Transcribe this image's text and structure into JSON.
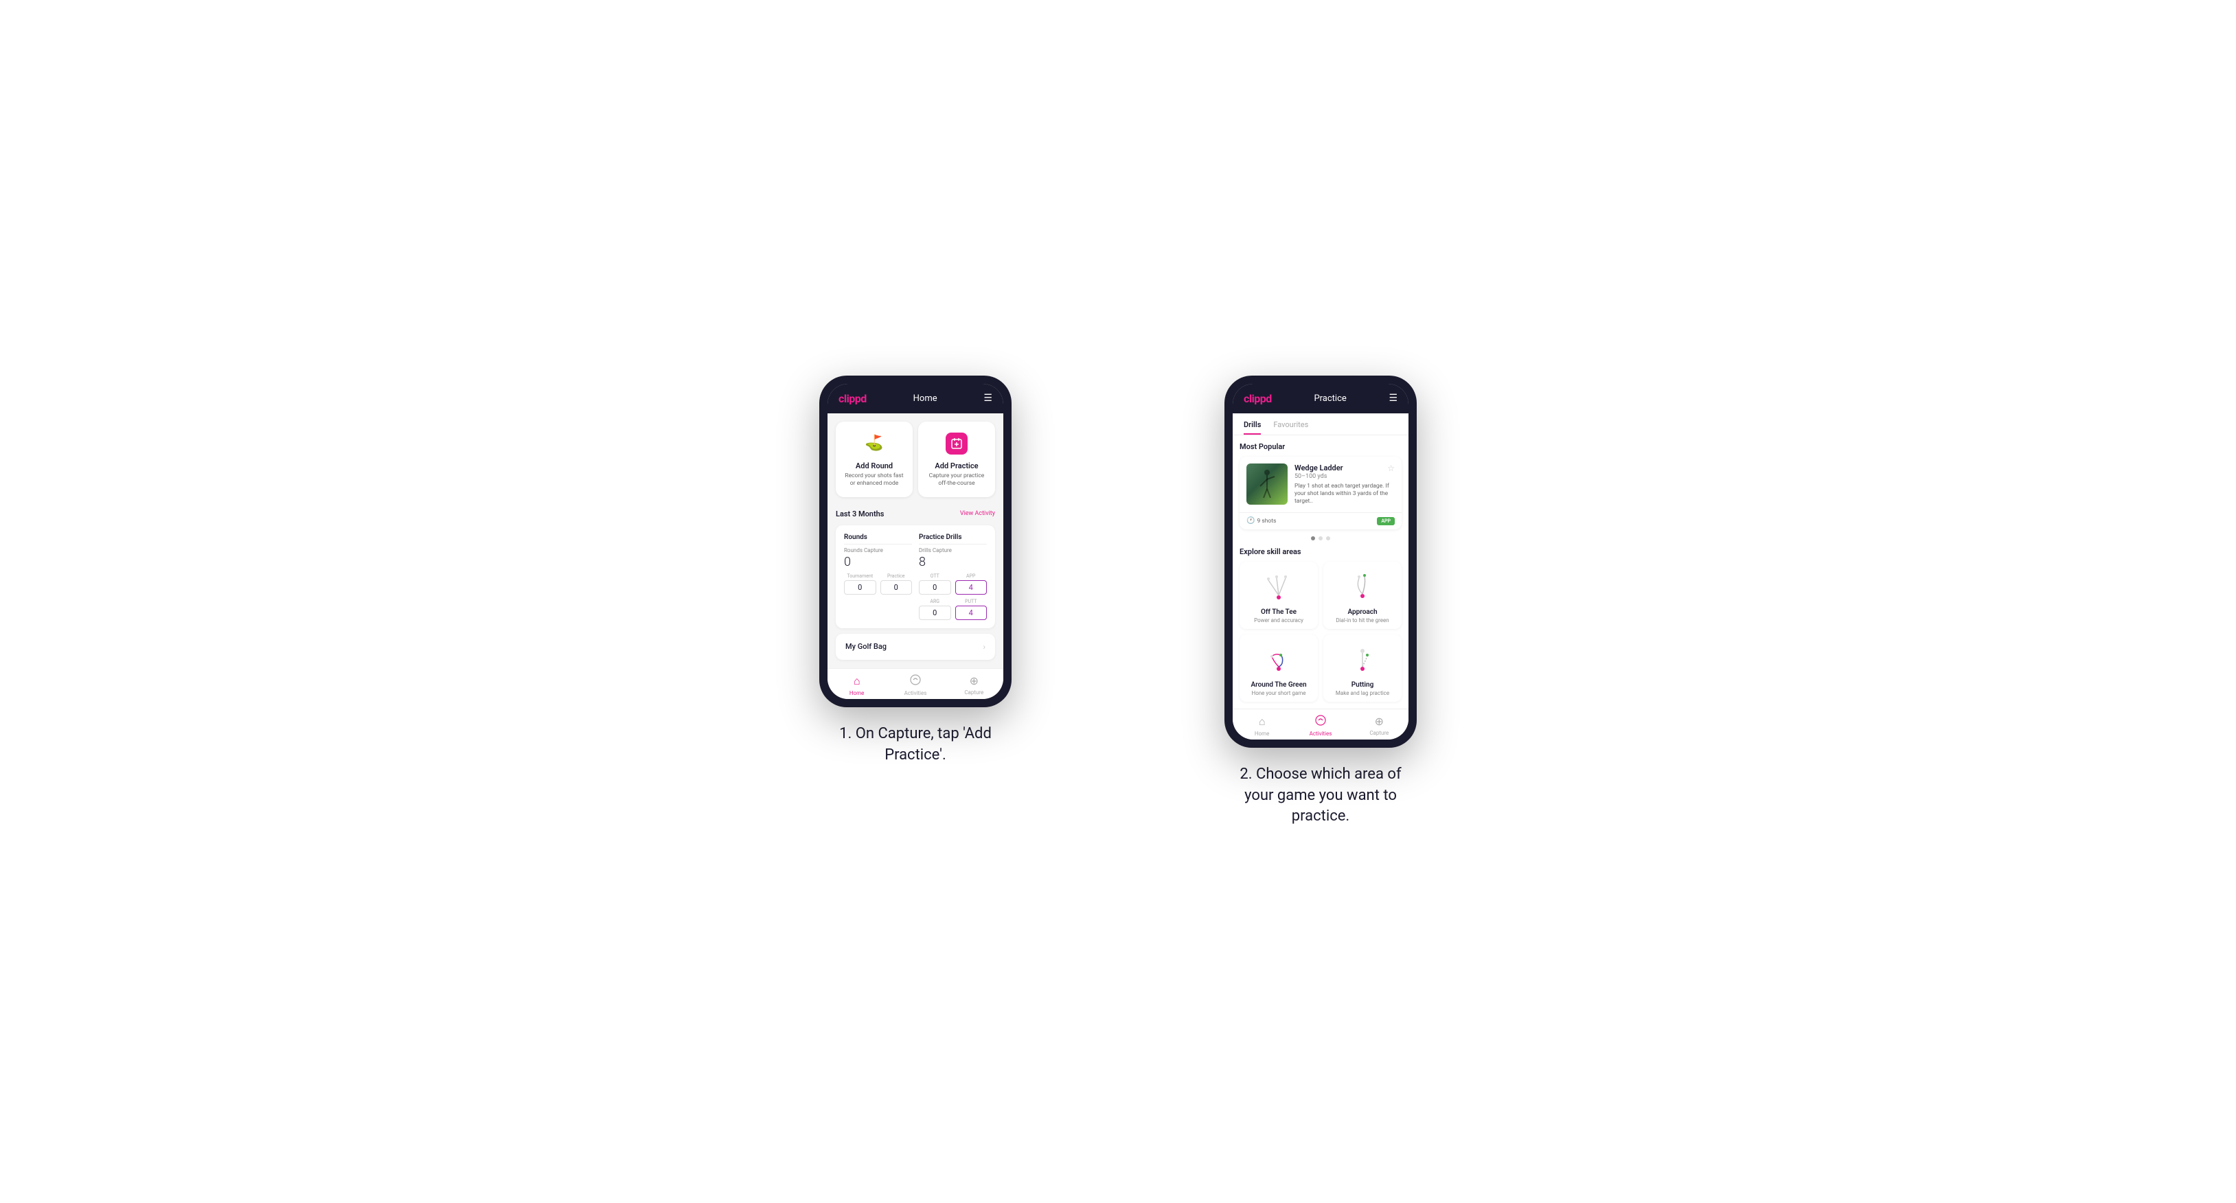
{
  "phone1": {
    "header": {
      "logo": "clippd",
      "title": "Home",
      "menu_icon": "☰"
    },
    "add_round": {
      "title": "Add Round",
      "description": "Record your shots fast or enhanced mode",
      "icon_type": "flag"
    },
    "add_practice": {
      "title": "Add Practice",
      "description": "Capture your practice off-the-course",
      "icon_type": "calendar-plus"
    },
    "stats": {
      "period_label": "Last 3 Months",
      "view_activity": "View Activity",
      "rounds_title": "Rounds",
      "rounds_capture_label": "Rounds Capture",
      "rounds_capture_value": "0",
      "tournament_label": "Tournament",
      "tournament_value": "0",
      "practice_label": "Practice",
      "practice_value": "0",
      "drills_title": "Practice Drills",
      "drills_capture_label": "Drills Capture",
      "drills_capture_value": "8",
      "ott_label": "OTT",
      "ott_value": "0",
      "app_label": "APP",
      "app_value": "4",
      "arg_label": "ARG",
      "arg_value": "0",
      "putt_label": "PUTT",
      "putt_value": "4"
    },
    "golf_bag": {
      "label": "My Golf Bag"
    },
    "nav": {
      "home": "Home",
      "activities": "Activities",
      "capture": "Capture",
      "home_active": true
    }
  },
  "phone2": {
    "header": {
      "logo": "clippd",
      "title": "Practice",
      "menu_icon": "☰"
    },
    "tabs": [
      {
        "label": "Drills",
        "active": true
      },
      {
        "label": "Favourites",
        "active": false
      }
    ],
    "most_popular": {
      "label": "Most Popular",
      "featured": {
        "title": "Wedge Ladder",
        "yards": "50–100 yds",
        "description": "Play 1 shot at each target yardage. If your shot lands within 3 yards of the target..",
        "shots": "9 shots",
        "badge": "APP"
      }
    },
    "explore": {
      "label": "Explore skill areas",
      "skills": [
        {
          "name": "Off The Tee",
          "description": "Power and accuracy",
          "type": "off-the-tee"
        },
        {
          "name": "Approach",
          "description": "Dial-in to hit the green",
          "type": "approach"
        },
        {
          "name": "Around The Green",
          "description": "Hone your short game",
          "type": "around-the-green"
        },
        {
          "name": "Putting",
          "description": "Make and lag practice",
          "type": "putting"
        }
      ]
    },
    "nav": {
      "home": "Home",
      "activities": "Activities",
      "capture": "Capture",
      "activities_active": true
    }
  },
  "captions": {
    "caption1": "1. On Capture, tap 'Add Practice'.",
    "caption2": "2. Choose which area of your game you want to practice."
  }
}
